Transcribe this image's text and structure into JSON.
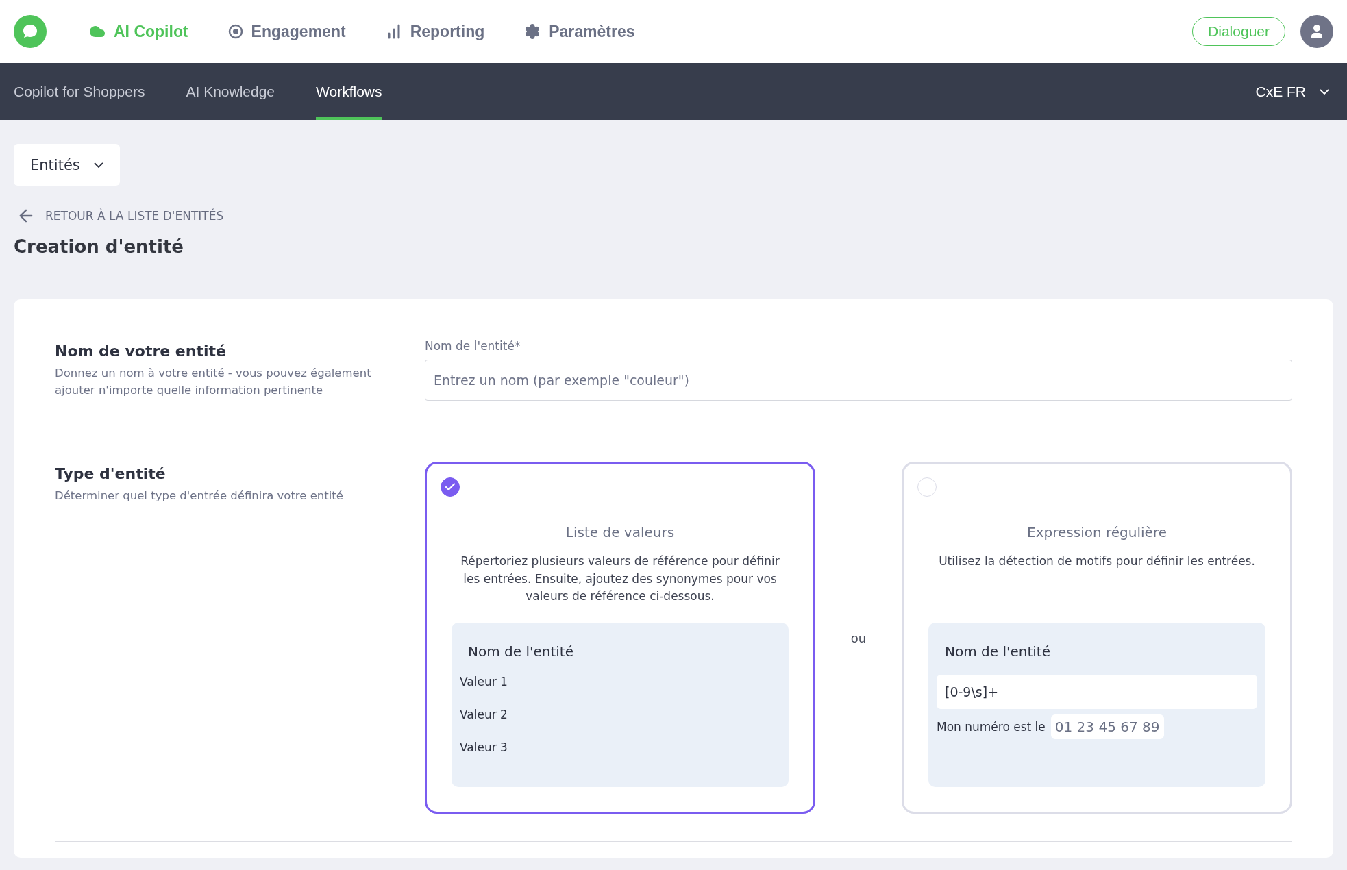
{
  "top_nav": {
    "items": [
      {
        "label": "AI Copilot",
        "kind": "cloud",
        "selected": true
      },
      {
        "label": "Engagement",
        "kind": "target",
        "selected": false
      },
      {
        "label": "Reporting",
        "kind": "bars",
        "selected": false
      },
      {
        "label": "Paramètres",
        "kind": "gear",
        "selected": false
      }
    ],
    "button": "Dialoguer"
  },
  "sub_nav": {
    "tabs": [
      {
        "label": "Copilot for Shoppers",
        "selected": false
      },
      {
        "label": "AI Knowledge",
        "selected": false
      },
      {
        "label": "Workflows",
        "selected": true
      }
    ],
    "workspace": "CxE FR"
  },
  "dropdown": "Entités",
  "back_link": "RETOUR À LA LISTE D'ENTITÉS",
  "page_title": "Creation d'entité",
  "name_section": {
    "title": "Nom de votre entité",
    "description": "Donnez un nom à votre entité - vous pouvez également ajouter n'importe quelle information pertinente",
    "field_label": "Nom de l'entité*",
    "placeholder": "Entrez un nom (par exemple \"couleur\")"
  },
  "type_section": {
    "title": "Type d'entité",
    "description": "Déterminer quel type d'entrée définira votre entité",
    "separator": "ou",
    "options": [
      {
        "kind": "list",
        "selected": true,
        "title": "Liste de valeurs",
        "description": "Répertoriez plusieurs valeurs de référence pour définir les entrées. Ensuite, ajoutez des synonymes pour vos valeurs de référence ci-dessous.",
        "example_title": "Nom de l'entité",
        "values": [
          "Valeur 1",
          "Valeur 2",
          "Valeur 3"
        ]
      },
      {
        "kind": "regex",
        "selected": false,
        "title": "Expression régulière",
        "description": "Utilisez la détection de motifs pour définir les entrées.",
        "example_title": "Nom de l'entité",
        "pattern": "[0-9\\s]+",
        "sample_label": "Mon numéro est le",
        "sample_value": "01 23 45 67 89"
      }
    ]
  }
}
